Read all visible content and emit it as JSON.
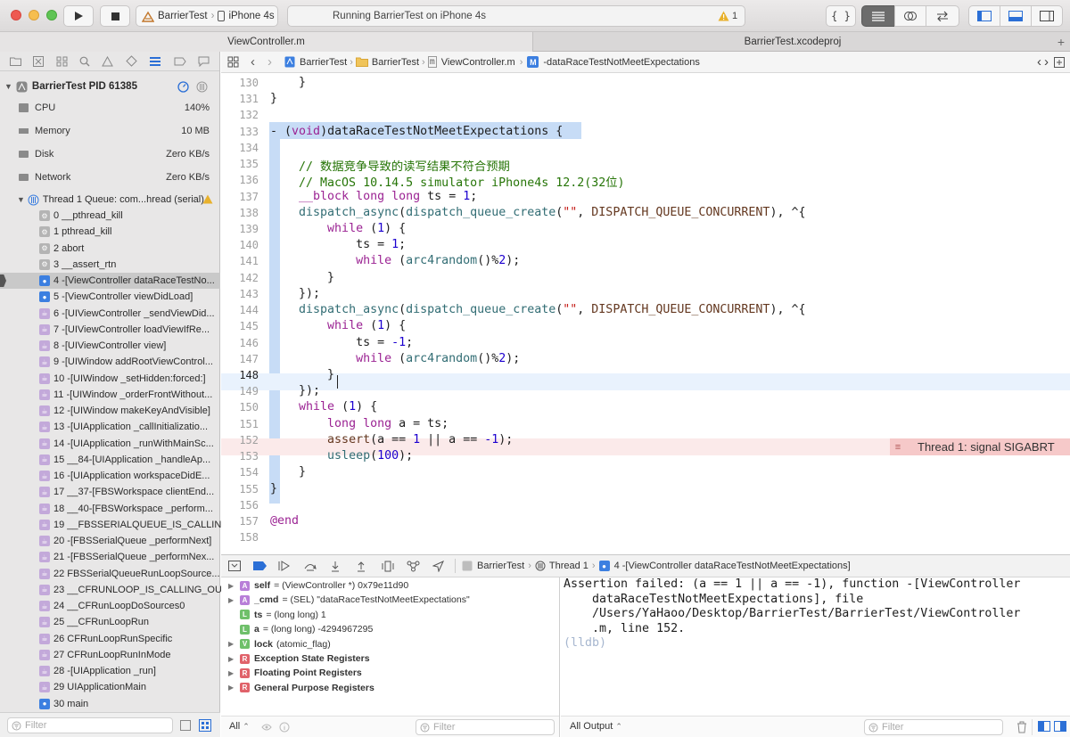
{
  "toolbar": {
    "scheme_target": "BarrierTest",
    "scheme_device": "iPhone 4s",
    "activity_text": "Running BarrierTest on iPhone 4s",
    "warning_count": "1"
  },
  "tabs": [
    {
      "label": "ViewController.m"
    },
    {
      "label": "BarrierTest.xcodeproj"
    }
  ],
  "navigator": {
    "process": "BarrierTest PID 61385",
    "gauges": [
      {
        "label": "CPU",
        "value": "140%"
      },
      {
        "label": "Memory",
        "value": "10 MB"
      },
      {
        "label": "Disk",
        "value": "Zero KB/s"
      },
      {
        "label": "Network",
        "value": "Zero KB/s"
      }
    ],
    "thread": "Thread 1 Queue: com...hread (serial)",
    "frames": [
      {
        "label": "0 __pthread_kill",
        "kind": "gear"
      },
      {
        "label": "1 pthread_kill",
        "kind": "gear"
      },
      {
        "label": "2 abort",
        "kind": "gear"
      },
      {
        "label": "3 __assert_rtn",
        "kind": "gear"
      },
      {
        "label": "4 -[ViewController dataRaceTestNo...",
        "kind": "user"
      },
      {
        "label": "5 -[ViewController viewDidLoad]",
        "kind": "user"
      },
      {
        "label": "6 -[UIViewController _sendViewDid...",
        "kind": "lib"
      },
      {
        "label": "7 -[UIViewController loadViewIfRe...",
        "kind": "lib"
      },
      {
        "label": "8 -[UIViewController view]",
        "kind": "lib"
      },
      {
        "label": "9 -[UIWindow addRootViewControl...",
        "kind": "lib"
      },
      {
        "label": "10 -[UIWindow _setHidden:forced:]",
        "kind": "lib"
      },
      {
        "label": "11 -[UIWindow _orderFrontWithout...",
        "kind": "lib"
      },
      {
        "label": "12 -[UIWindow makeKeyAndVisible]",
        "kind": "lib"
      },
      {
        "label": "13 -[UIApplication _callInitializatio...",
        "kind": "lib"
      },
      {
        "label": "14 -[UIApplication _runWithMainSc...",
        "kind": "lib"
      },
      {
        "label": "15 __84-[UIApplication _handleAp...",
        "kind": "lib"
      },
      {
        "label": "16 -[UIApplication workspaceDidE...",
        "kind": "lib"
      },
      {
        "label": "17 __37-[FBSWorkspace clientEnd...",
        "kind": "lib"
      },
      {
        "label": "18 __40-[FBSWorkspace _perform...",
        "kind": "lib"
      },
      {
        "label": "19 __FBSSERIALQUEUE_IS_CALLIN...",
        "kind": "lib"
      },
      {
        "label": "20 -[FBSSerialQueue _performNext]",
        "kind": "lib"
      },
      {
        "label": "21 -[FBSSerialQueue _performNex...",
        "kind": "lib"
      },
      {
        "label": "22 FBSSerialQueueRunLoopSource...",
        "kind": "lib"
      },
      {
        "label": "23 __CFRUNLOOP_IS_CALLING_OU...",
        "kind": "lib"
      },
      {
        "label": "24 __CFRunLoopDoSources0",
        "kind": "lib"
      },
      {
        "label": "25 __CFRunLoopRun",
        "kind": "lib"
      },
      {
        "label": "26 CFRunLoopRunSpecific",
        "kind": "lib"
      },
      {
        "label": "27 CFRunLoopRunInMode",
        "kind": "lib"
      },
      {
        "label": "28 -[UIApplication _run]",
        "kind": "lib"
      },
      {
        "label": "29 UIApplicationMain",
        "kind": "lib"
      },
      {
        "label": "30 main",
        "kind": "user"
      }
    ],
    "filter_placeholder": "Filter"
  },
  "jumpbar": {
    "project": "BarrierTest",
    "group": "BarrierTest",
    "file": "ViewController.m",
    "method": "-dataRaceTestNotMeetExpectations"
  },
  "editor": {
    "lines": [
      {
        "n": "130",
        "text": "    }"
      },
      {
        "n": "131",
        "text": "}"
      },
      {
        "n": "132",
        "text": ""
      },
      {
        "n": "133",
        "text": "- (void)dataRaceTestNotMeetExpectations {"
      },
      {
        "n": "134",
        "text": ""
      },
      {
        "n": "135",
        "text": "    // 数据竞争导致的读写结果不符合预期"
      },
      {
        "n": "136",
        "text": "    // MacOS 10.14.5 simulator iPhone4s 12.2(32位)"
      },
      {
        "n": "137",
        "text": "    __block long long ts = 1;"
      },
      {
        "n": "138",
        "text": "    dispatch_async(dispatch_queue_create(\"\", DISPATCH_QUEUE_CONCURRENT), ^{"
      },
      {
        "n": "139",
        "text": "        while (1) {"
      },
      {
        "n": "140",
        "text": "            ts = 1;"
      },
      {
        "n": "141",
        "text": "            while (arc4random()%2);"
      },
      {
        "n": "142",
        "text": "        }"
      },
      {
        "n": "143",
        "text": "    });"
      },
      {
        "n": "144",
        "text": "    dispatch_async(dispatch_queue_create(\"\", DISPATCH_QUEUE_CONCURRENT), ^{"
      },
      {
        "n": "145",
        "text": "        while (1) {"
      },
      {
        "n": "146",
        "text": "            ts = -1;"
      },
      {
        "n": "147",
        "text": "            while (arc4random()%2);"
      },
      {
        "n": "148",
        "text": "        }"
      },
      {
        "n": "149",
        "text": "    });"
      },
      {
        "n": "150",
        "text": "    while (1) {"
      },
      {
        "n": "151",
        "text": "        long long a = ts;"
      },
      {
        "n": "152",
        "text": "        assert(a == 1 || a == -1);"
      },
      {
        "n": "153",
        "text": "        usleep(100);"
      },
      {
        "n": "154",
        "text": "    }"
      },
      {
        "n": "155",
        "text": "}"
      },
      {
        "n": "156",
        "text": ""
      },
      {
        "n": "157",
        "text": "@end"
      },
      {
        "n": "158",
        "text": ""
      }
    ],
    "error_annotation": "Thread 1: signal SIGABRT"
  },
  "debug_bar": {
    "crumb_project": "BarrierTest",
    "crumb_thread": "Thread 1",
    "crumb_frame": "4 -[ViewController dataRaceTestNotMeetExpectations]"
  },
  "variables": [
    {
      "badge": "A",
      "name": "self",
      "value": "= (ViewController *) 0x79e11d90",
      "color": "#b87fd8",
      "expandable": true
    },
    {
      "badge": "A",
      "name": "_cmd",
      "value": "= (SEL) \"dataRaceTestNotMeetExpectations\"",
      "color": "#b87fd8",
      "expandable": true
    },
    {
      "badge": "L",
      "name": "ts",
      "value": "= (long long) 1",
      "color": "#6fc06a",
      "expandable": false
    },
    {
      "badge": "L",
      "name": "a",
      "value": "= (long long) -4294967295",
      "color": "#6fc06a",
      "expandable": false
    },
    {
      "badge": "V",
      "name": "lock",
      "value": "(atomic_flag)",
      "color": "#6fc06a",
      "expandable": true
    },
    {
      "badge": "R",
      "name": "Exception State Registers",
      "value": "",
      "color": "#e0626a",
      "expandable": true
    },
    {
      "badge": "R",
      "name": "Floating Point Registers",
      "value": "",
      "color": "#e0626a",
      "expandable": true
    },
    {
      "badge": "R",
      "name": "General Purpose Registers",
      "value": "",
      "color": "#e0626a",
      "expandable": true
    }
  ],
  "vars_footer": {
    "scope": "All",
    "filter_placeholder": "Filter"
  },
  "console": {
    "lines": [
      "Assertion failed: (a == 1 || a == -1), function -[ViewController",
      "    dataRaceTestNotMeetExpectations], file",
      "    /Users/YaHaoo/Desktop/BarrierTest/BarrierTest/ViewController",
      "    .m, line 152."
    ],
    "prompt": "(lldb)",
    "output_selector": "All Output",
    "filter_placeholder": "Filter"
  },
  "colors": {
    "selection": "#c7dcf6",
    "error_line": "#fbeaea",
    "error_badge": "#f6c9c9",
    "accent": "#2b6fd6"
  }
}
